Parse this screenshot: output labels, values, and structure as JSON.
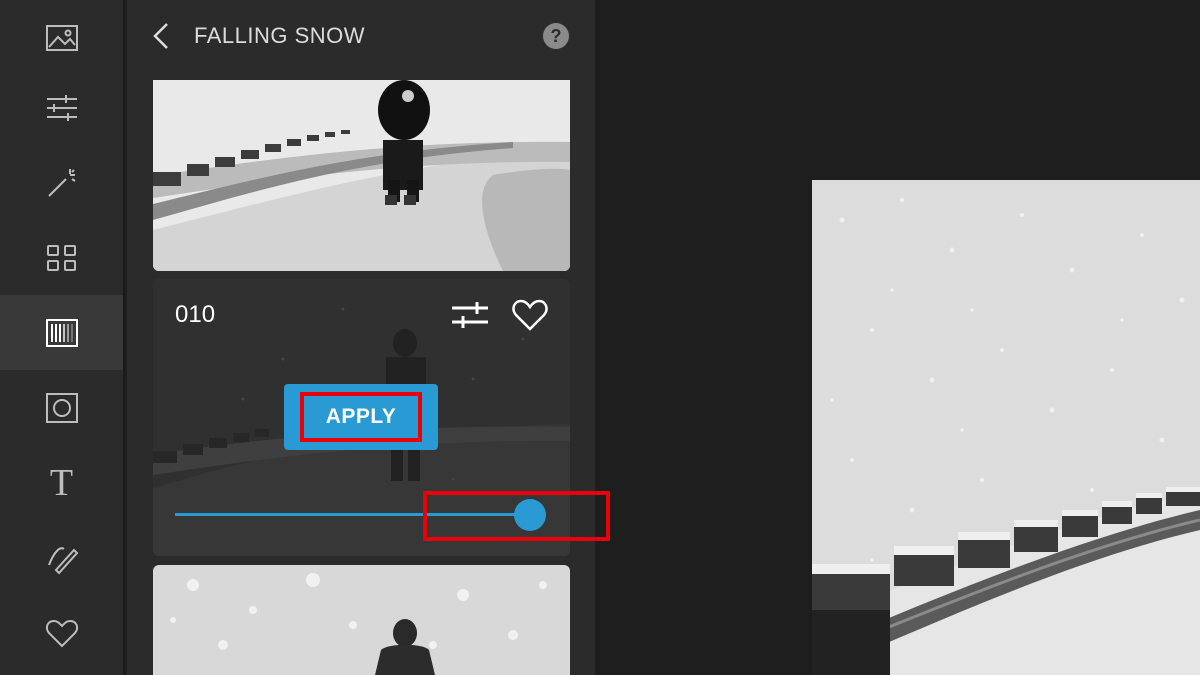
{
  "rail": {
    "items": [
      {
        "icon": "image-icon"
      },
      {
        "icon": "sliders-icon"
      },
      {
        "icon": "magic-wand-icon"
      },
      {
        "icon": "grid-icon"
      },
      {
        "icon": "filters-icon",
        "active": true
      },
      {
        "icon": "frame-icon"
      },
      {
        "icon": "text-icon",
        "glyph": "T"
      },
      {
        "icon": "brush-icon"
      },
      {
        "icon": "heart-icon"
      }
    ]
  },
  "panel": {
    "title": "FALLING SNOW",
    "help_glyph": "?",
    "card": {
      "name": "010",
      "apply_label": "APPLY",
      "intensity": 1.0
    }
  },
  "colors": {
    "accent": "#2a9ad4",
    "highlight": "#e8000b",
    "panel_bg": "#2b2b2b",
    "canvas_bg": "#1e1e1e"
  }
}
